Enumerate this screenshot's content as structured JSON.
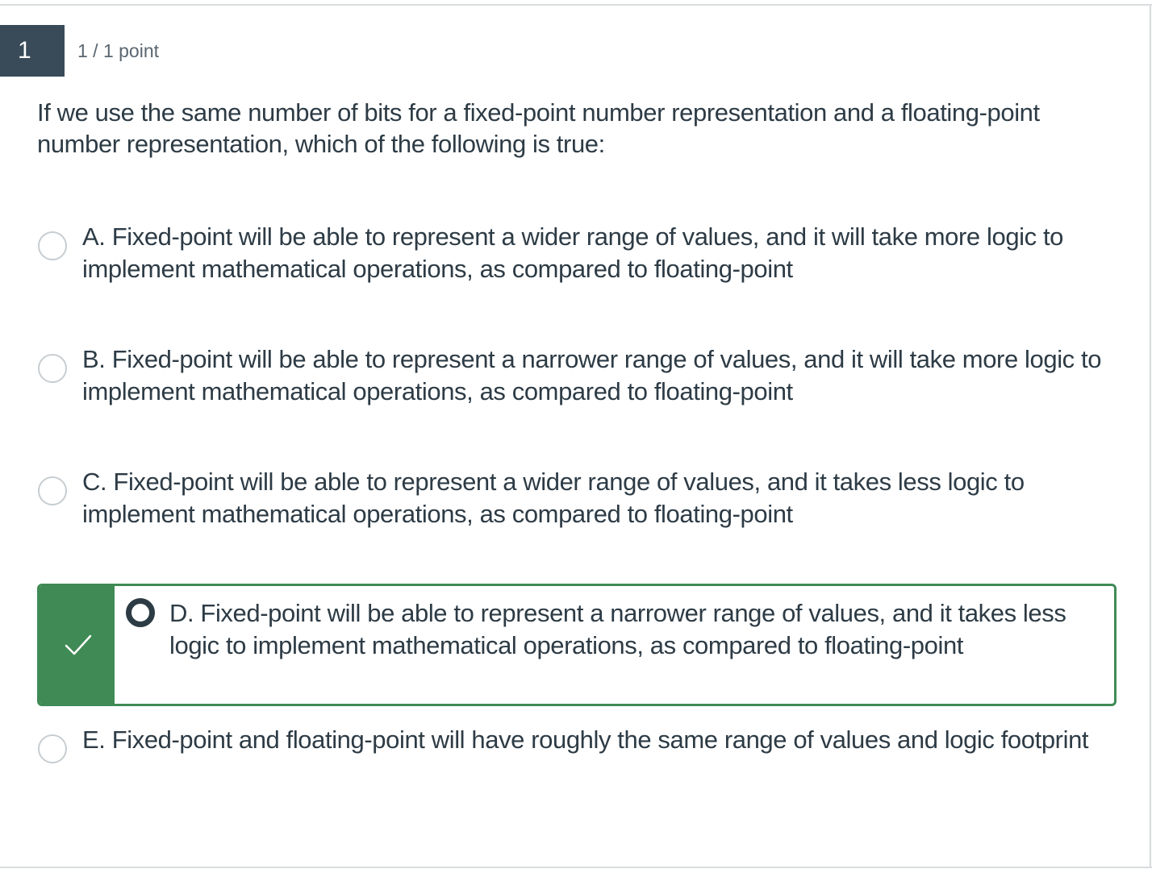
{
  "question": {
    "number": "1",
    "points": "1 / 1 point",
    "text": "If we use the same number of bits for a fixed-point number representation and a floating-point number representation, which of the following is true:"
  },
  "answers": [
    {
      "label": "A. Fixed-point will be able to represent a wider range of values, and it will take more logic to implement mathematical operations, as compared to floating-point",
      "selected": false,
      "correct": false
    },
    {
      "label": "B. Fixed-point will be able to represent a narrower range of values, and it will take more logic to implement mathematical operations, as compared to floating-point",
      "selected": false,
      "correct": false
    },
    {
      "label": "C. Fixed-point will be able to represent a wider range of values, and it takes less logic to implement mathematical operations, as compared to floating-point",
      "selected": false,
      "correct": false
    },
    {
      "label": "D. Fixed-point will be able to represent a narrower range of values, and it takes less logic to implement mathematical operations, as compared to floating-point",
      "selected": true,
      "correct": true
    },
    {
      "label": "E. Fixed-point and floating-point will have roughly the same range of values and logic footprint",
      "selected": false,
      "correct": false
    }
  ],
  "icons": {
    "correct_marker": "check-icon"
  },
  "colors": {
    "question_number_bg": "#394b58",
    "correct_green": "#3f8a55",
    "text": "#2d3b45",
    "radio_border": "#c7cdd1"
  }
}
